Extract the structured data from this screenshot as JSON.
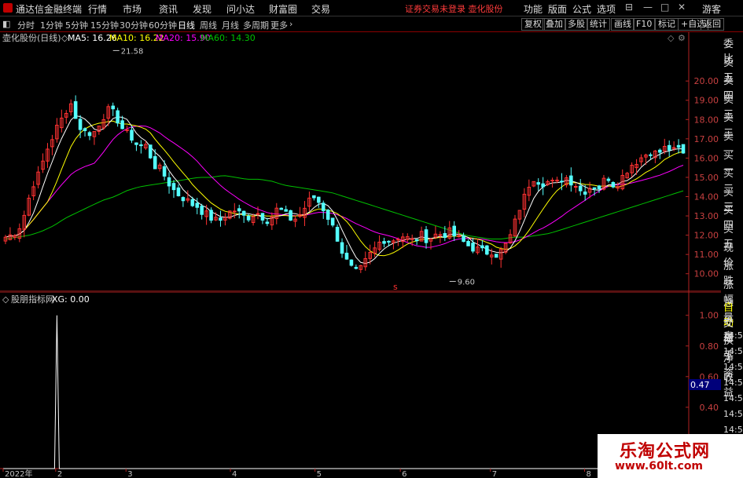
{
  "app": {
    "title": "通达信金融终端"
  },
  "menu": [
    "行情",
    "市场",
    "资讯",
    "发现",
    "问小达",
    "财富圈",
    "交易"
  ],
  "notice": "证券交易未登录  壶化股份",
  "top_right": [
    "功能",
    "版面",
    "公式",
    "选项",
    "游客"
  ],
  "periods": [
    "分时",
    "1分钟",
    "5分钟",
    "15分钟",
    "30分钟",
    "60分钟",
    "日线",
    "周线",
    "月线",
    "多周期",
    "更多"
  ],
  "active_period": "日线",
  "right_buttons": [
    "复权",
    "叠加",
    "多股",
    "统计",
    "画线",
    "F10",
    "标记",
    "+自选",
    "返回"
  ],
  "main_legend": {
    "name": "壶化股份(日线)",
    "ma5": "MA5: 16.26",
    "ma10": "MA10: 16.22",
    "ma20": "MA20: 15.90",
    "ma60": "MA60: 14.30"
  },
  "sub_legend": {
    "name": "股朋指标网",
    "xg": "XG: 0.00"
  },
  "right_panel": [
    "委比",
    "卖五",
    "卖四",
    "卖三",
    "卖二",
    "卖一",
    "买一",
    "买二",
    "买三",
    "买四",
    "买五",
    "现价",
    "涨跌",
    "涨幅",
    "总量",
    "外盘",
    "换手",
    "净资",
    "收益"
  ],
  "right_panel_low": [
    "自动",
    "交易",
    "14:55",
    "14:55",
    "14:55",
    "14:55",
    "14:56",
    "14:56",
    "14:56",
    "14:56",
    "14:56"
  ],
  "sub_cursor_value": "0.47",
  "watermark": {
    "line1": "乐淘公式网",
    "line2": "www.60lt.com"
  },
  "colors": {
    "up": "#ff3232",
    "down": "#54ffff",
    "ma5": "#ffffff",
    "ma10": "#ffff00",
    "ma20": "#ff00ff",
    "ma60": "#00c000",
    "axis": "#b22222"
  },
  "chart_data": {
    "type": "candlestick",
    "title": "壶化股份(日线)",
    "ylim": [
      9.5,
      21.8
    ],
    "yticks": [
      10.0,
      11.0,
      12.0,
      13.0,
      14.0,
      15.0,
      16.0,
      17.0,
      18.0,
      19.0,
      20.0
    ],
    "x_month_labels": [
      "2022年",
      "2",
      "3",
      "4",
      "5",
      "6",
      "7",
      "8"
    ],
    "annotations": [
      {
        "text": "21.58",
        "value": 21.58
      },
      {
        "text": "9.60",
        "value": 9.6
      }
    ],
    "close_path": [
      11.9,
      12.0,
      12.2,
      12.6,
      13.5,
      14.6,
      15.0,
      15.8,
      16.6,
      17.2,
      17.8,
      18.2,
      19.0,
      18.3,
      17.4,
      17.6,
      17.0,
      17.6,
      18.0,
      18.5,
      18.4,
      18.0,
      17.5,
      17.2,
      17.0,
      16.5,
      16.8,
      16.2,
      15.6,
      15.4,
      15.0,
      14.5,
      14.2,
      14.0,
      13.8,
      13.6,
      13.5,
      13.2,
      13.0,
      12.8,
      12.7,
      13.0,
      13.2,
      13.3,
      13.1,
      12.9,
      13.0,
      13.2,
      13.0,
      12.8,
      13.0,
      13.4,
      13.2,
      12.9,
      12.8,
      13.0,
      13.4,
      13.8,
      14.0,
      13.6,
      13.2,
      12.6,
      12.0,
      11.2,
      10.6,
      10.2,
      10.0,
      10.4,
      10.9,
      11.2,
      11.6,
      11.8,
      11.7,
      11.8,
      12.0,
      11.9,
      11.7,
      11.8,
      12.0,
      11.8,
      11.9,
      12.1,
      12.0,
      12.2,
      12.0,
      11.8,
      11.6,
      11.4,
      11.3,
      11.2,
      11.1,
      11.2,
      11.0,
      11.2,
      11.6,
      12.2,
      13.2,
      13.8,
      14.6,
      15.0,
      14.8,
      14.7,
      14.8,
      14.6,
      14.9,
      15.0,
      14.8,
      14.6,
      14.2,
      14.4,
      14.6,
      14.4,
      14.8,
      15.0,
      14.6,
      14.8,
      15.2,
      15.6,
      15.8,
      16.0,
      16.2,
      16.4,
      16.2,
      16.4,
      16.6,
      16.3,
      16.5,
      16.2
    ],
    "ma60_path": [
      11.8,
      11.9,
      12.0,
      12.2,
      12.5,
      12.9,
      13.2,
      13.5,
      13.8,
      14.0,
      14.3,
      14.5,
      14.6,
      14.7,
      14.8,
      14.9,
      15.0,
      15.0,
      15.1,
      15.0,
      14.9,
      14.9,
      14.8,
      14.6,
      14.5,
      14.4,
      14.3,
      14.2,
      14.0,
      13.8,
      13.6,
      13.4,
      13.2,
      13.0,
      12.8,
      12.6,
      12.4,
      12.2,
      12.0,
      11.9,
      11.8,
      11.8,
      11.9,
      11.9,
      12.0,
      12.1,
      12.3,
      12.5,
      12.7,
      12.9,
      13.1,
      13.3,
      13.5,
      13.7,
      13.9,
      14.1,
      14.3
    ],
    "sub_indicator": {
      "name": "股朋指标网",
      "series": "XG",
      "ylim": [
        0,
        1.06
      ],
      "yticks": [
        0.0,
        0.2,
        0.4,
        0.6,
        0.8,
        1.0
      ],
      "signal_index": 11,
      "signal_value": 1.0
    }
  }
}
